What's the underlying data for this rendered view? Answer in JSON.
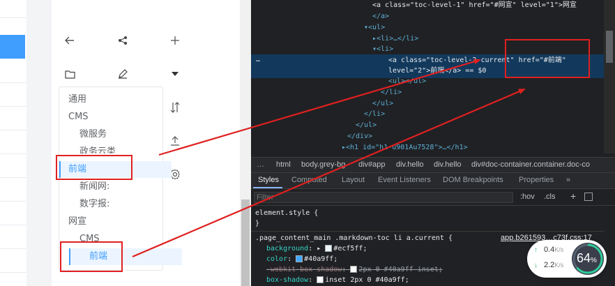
{
  "tree": {
    "items": [
      {
        "label": "通用",
        "level": 1,
        "active": false
      },
      {
        "label": "CMS",
        "level": 1,
        "active": false
      },
      {
        "label": "微服务",
        "level": 2,
        "active": false
      },
      {
        "label": "政务云类",
        "level": 2,
        "active": false
      },
      {
        "label": "前端",
        "level": 2,
        "active": true
      },
      {
        "label": "新闻网:",
        "level": 2,
        "active": false
      },
      {
        "label": "数字报:",
        "level": 2,
        "active": false
      },
      {
        "label": "网宣",
        "level": 1,
        "active": false
      },
      {
        "label": "CMS",
        "level": 2,
        "active": false
      },
      {
        "label": "前端",
        "level": 2,
        "active": true
      }
    ]
  },
  "devtools": {
    "elements": {
      "lines": [
        "<a class=\"toc-level-1\" href=\"#网宣\" level=\"1\">网宣",
        "</a>",
        "▾<ul>",
        "▸<li>…</li>",
        "▾<li>",
        "<a class=\"toc-level-2 current\" href=\"#前端\"",
        "level=\"2\">前端</a> == $0",
        "<ul></ul>",
        "</li>",
        "</ul>",
        "</li>",
        "</ul>",
        "</div>",
        "▸<h1 id=\"h1-u901Au7528\">…</h1>"
      ],
      "ellipsis": "…",
      "selected_marker": "== $0"
    },
    "breadcrumbs": [
      "…",
      "html",
      "body.grey-bg",
      "div#app",
      "div.hello",
      "div.hello",
      "div#doc-container.container.doc-co"
    ],
    "tabs": [
      "Styles",
      "Computed",
      "Layout",
      "Event Listeners",
      "DOM Breakpoints",
      "Properties",
      "»"
    ],
    "filter": {
      "placeholder": "Filter",
      "hov": ":hov",
      "cls": ".cls",
      "plus": "+"
    },
    "styles": {
      "element_style": "element.style {",
      "close": "}",
      "rule_selector": ".page_content_main .markdown-toc li a.current {",
      "rule_source": "app.b261593…c73f.css:17",
      "declarations": [
        {
          "prop": "background",
          "value": "#ecf5ff;",
          "swatch": "#ecf5ff",
          "struck": false,
          "prefix": "▸ "
        },
        {
          "prop": "color",
          "value": "#40a9ff;",
          "swatch": "#40a9ff",
          "struck": false,
          "prefix": ""
        },
        {
          "prop": "-webkit-box-shadow",
          "value": "2px 0 #40a9ff inset;",
          "swatch": "#40a9ff",
          "struck": true,
          "prefix": ""
        },
        {
          "prop": "box-shadow",
          "value": "inset 2px 0 #40a9ff;",
          "swatch": "#40a9ff",
          "struck": false,
          "prefix": ""
        }
      ],
      "trailing": "}"
    },
    "network": {
      "up": "0.4",
      "up_unit": "K/s",
      "down": "2.2",
      "down_unit": "K/s",
      "percent": "64",
      "percent_unit": "%"
    }
  },
  "colors": {
    "accent": "#409eff",
    "annotation": "#e02020",
    "selection": "#12395c"
  }
}
